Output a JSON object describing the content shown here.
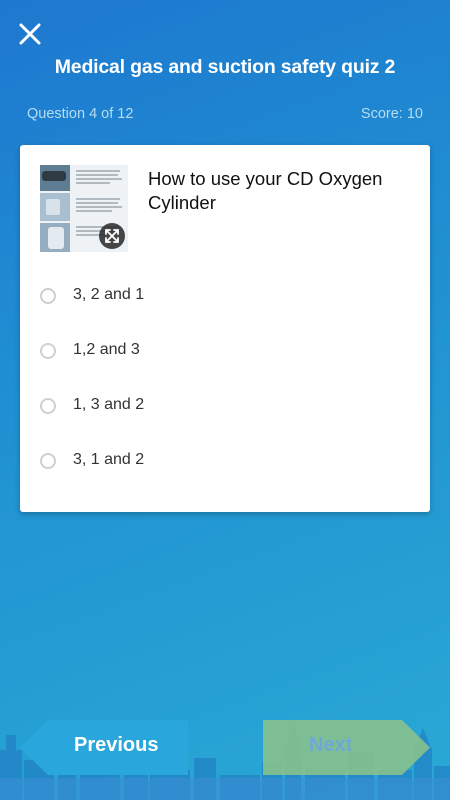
{
  "header": {
    "close_icon": "close-icon",
    "title": "Medical gas and suction safety quiz 2"
  },
  "status": {
    "progress": "Question 4 of 12",
    "score": "Score: 10"
  },
  "question": {
    "thumbnail_icon": "expand-icon",
    "text": "How to use your CD Oxygen Cylinder"
  },
  "options": [
    {
      "label": "3, 2 and 1"
    },
    {
      "label": "1,2 and 3"
    },
    {
      "label": "1, 3 and 2"
    },
    {
      "label": "3, 1 and 2"
    }
  ],
  "footer": {
    "previous_label": "Previous",
    "next_label": "Next",
    "previous_color": "#29a7dc",
    "next_color": "#8dc38a"
  }
}
